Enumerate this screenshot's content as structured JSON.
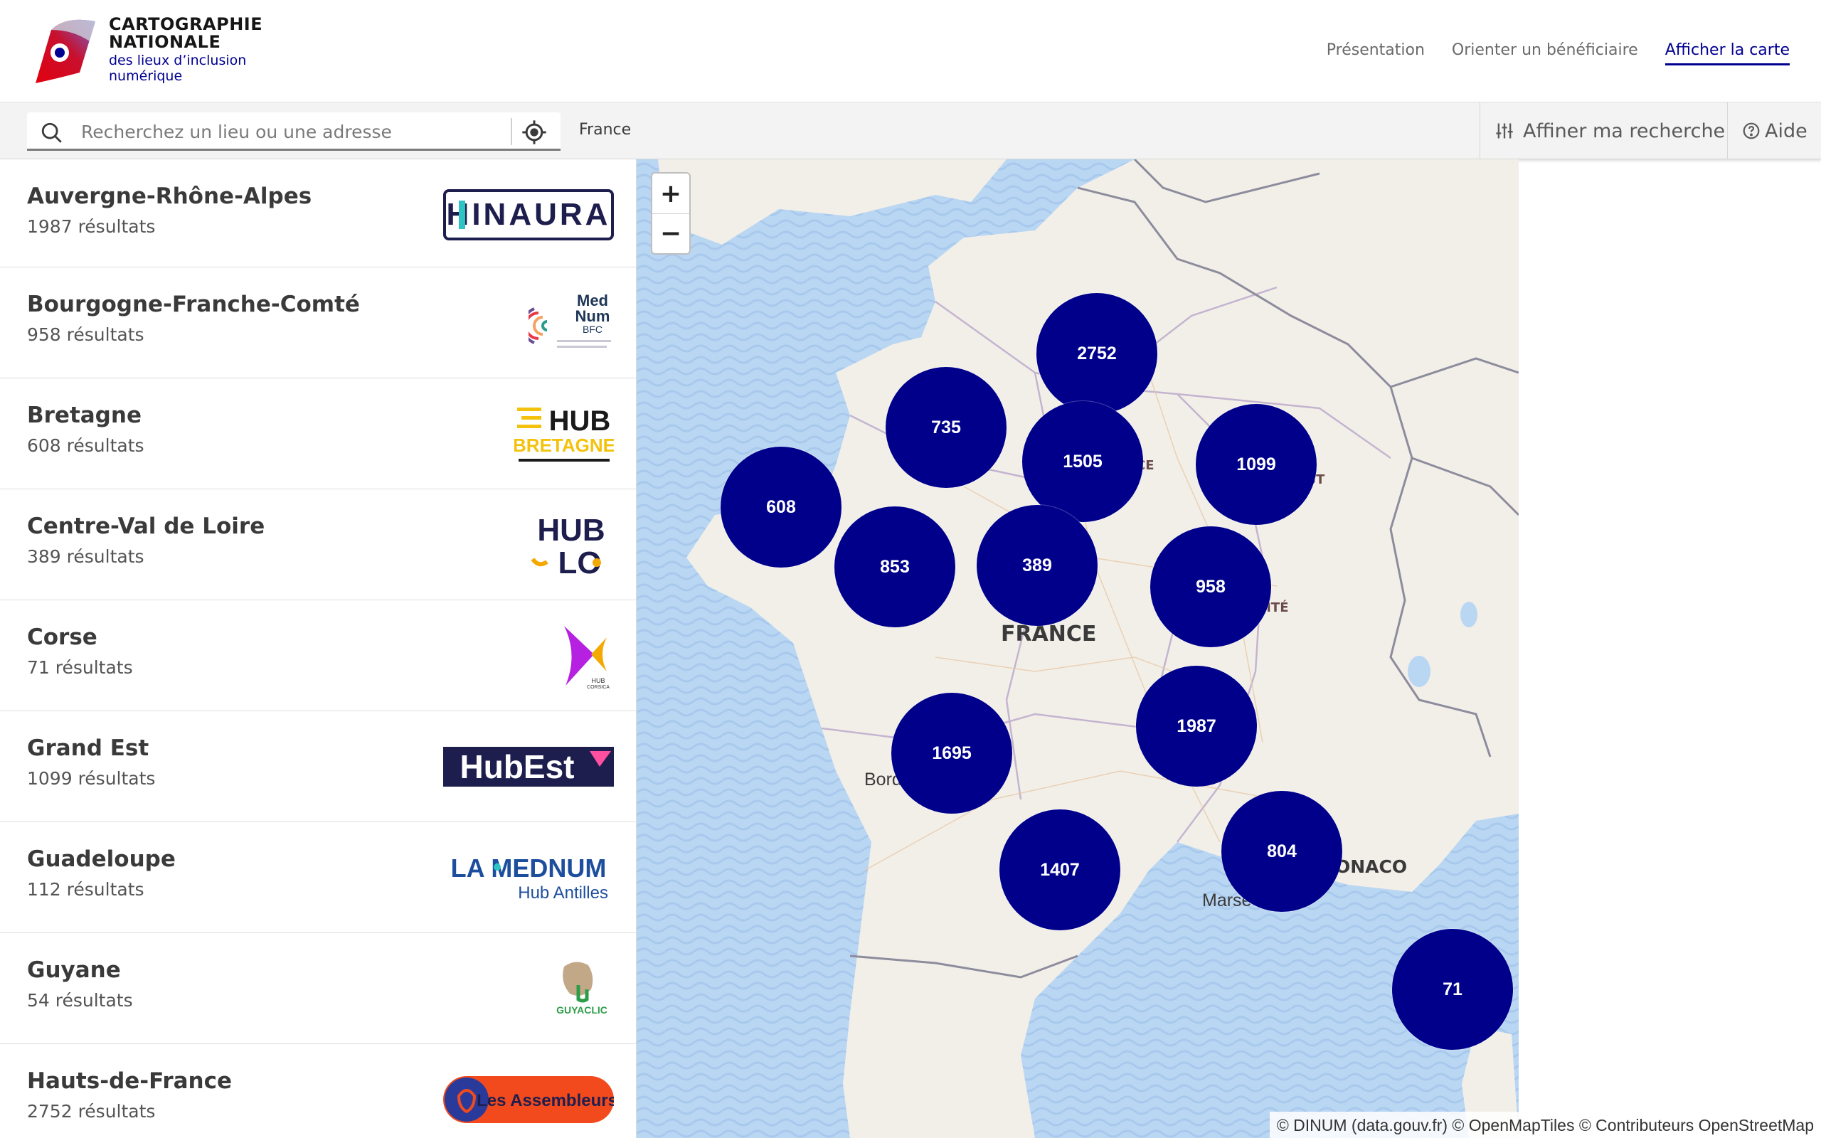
{
  "header": {
    "logo": {
      "line1": "CARTOGRAPHIE",
      "line2": "NATIONALE",
      "line3": "des lieux d’inclusion",
      "line4": "numérique"
    },
    "nav": [
      {
        "label": "Présentation",
        "active": false
      },
      {
        "label": "Orienter un bénéficiaire",
        "active": false
      },
      {
        "label": "Afficher la carte",
        "active": true
      }
    ]
  },
  "search": {
    "placeholder": "Recherchez un lieu ou une adresse",
    "value": "",
    "current_area": "France",
    "refine_label": "Affiner ma recherche",
    "help_label": "Aide"
  },
  "regions": [
    {
      "name": "Auvergne-Rhône-Alpes",
      "count": "1987 résultats",
      "logo_text": "HINAURA"
    },
    {
      "name": "Bourgogne-Franche-Comté",
      "count": "958 résultats",
      "logo_text": "Med Num BFC"
    },
    {
      "name": "Bretagne",
      "count": "608 résultats",
      "logo_text": "HUB BRETAGNE"
    },
    {
      "name": "Centre-Val de Loire",
      "count": "389 résultats",
      "logo_text": "HUB LO"
    },
    {
      "name": "Corse",
      "count": "71 résultats",
      "logo_text": "HUB CORSICA"
    },
    {
      "name": "Grand Est",
      "count": "1099 résultats",
      "logo_text": "HubEst"
    },
    {
      "name": "Guadeloupe",
      "count": "112 résultats",
      "logo_text": "LA MEDNUM Hub Antilles"
    },
    {
      "name": "Guyane",
      "count": "54 résultats",
      "logo_text": "GUYACLIC"
    },
    {
      "name": "Hauts-de-France",
      "count": "2752 résultats",
      "logo_text": "Les Assembleurs"
    }
  ],
  "map": {
    "zoom_in": "+",
    "zoom_out": "−",
    "clusters": [
      "2752",
      "735",
      "1505",
      "1099",
      "608",
      "853",
      "389",
      "958",
      "1987",
      "1695",
      "1407",
      "804",
      "71"
    ],
    "labels": {
      "country": "FRANCE",
      "bordeaux": "Bord",
      "marseille": "Marse",
      "monaco": "ONACO",
      "est": "ST",
      "comte": "MTÉ",
      "cee": "CE"
    },
    "attribution": "© DINUM (data.gouv.fr) © OpenMapTiles © Contributeurs OpenStreetMap"
  },
  "colors": {
    "primary": "#000091",
    "cluster": "#00008b",
    "water": "#b9d6f2",
    "land": "#f2efe9"
  }
}
